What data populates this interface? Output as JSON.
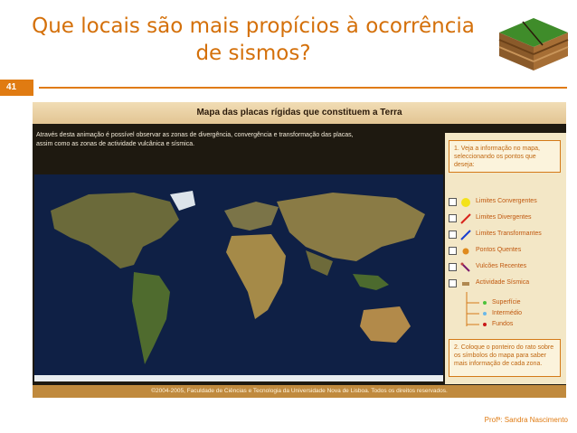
{
  "slide": {
    "title_line1": "Que locais são mais propícios à ocorrência",
    "title_line2": "de sismos?",
    "number": "41",
    "author": "Profª: Sandra Nascimento"
  },
  "app": {
    "header": "Mapa das placas rígidas que constituem a Terra",
    "intro_line1": "Através desta animação é possível observar as zonas de divergência, convergência e transformação das placas,",
    "intro_line2": "assim como as zonas de actividade vulcânica e sísmica.",
    "step1": "1. Veja a informação no mapa, seleccionando os pontos que deseja:",
    "step2": "2. Coloque o ponteiro do rato sobre os símbolos do mapa para saber mais informação de cada zona.",
    "legend": [
      {
        "label": "Limites Convergentes",
        "icon": "convergent-icon",
        "color": "#f3e21a"
      },
      {
        "label": "Limites Divergentes",
        "icon": "divergent-line-icon",
        "color": "#d8241c"
      },
      {
        "label": "Limites Transformantes",
        "icon": "transform-line-icon",
        "color": "#1a3fd0"
      },
      {
        "label": "Pontos Quentes",
        "icon": "hotspot-dot-icon",
        "color": "#e08a1c"
      },
      {
        "label": "Vulcões Recentes",
        "icon": "volcano-icon",
        "color": "#7a1a6a"
      },
      {
        "label": "Actividade Sísmica",
        "icon": "seismic-icon",
        "color": "#b08850"
      }
    ],
    "depths": [
      {
        "label": "Superfície",
        "color": "#4dc23a"
      },
      {
        "label": "Intermédio",
        "color": "#6ab8e8"
      },
      {
        "label": "Fundos",
        "color": "#c81818"
      }
    ],
    "footer": "©2004-2005, Faculdade de Ciências e Tecnologia da Universidade Nova de Lisboa. Todos os direitos reservados."
  },
  "colors": {
    "accent": "#e07b12",
    "title": "#d4700a"
  }
}
